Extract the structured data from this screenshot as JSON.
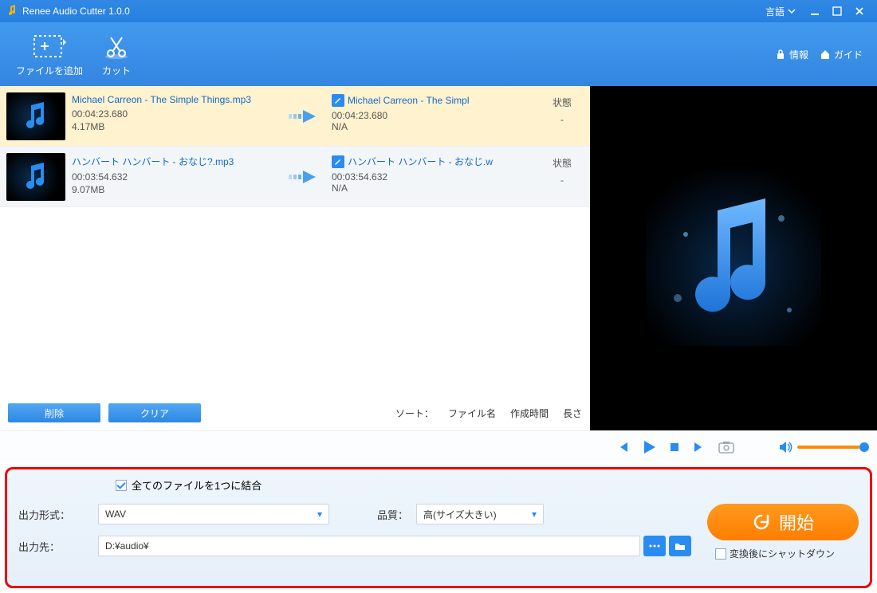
{
  "titlebar": {
    "title": "Renee Audio Cutter 1.0.0",
    "language_label": "言語"
  },
  "toolbar": {
    "add_file": "ファイルを追加",
    "cut": "カット",
    "info": "情報",
    "guide": "ガイド"
  },
  "filelist": {
    "items": [
      {
        "source_name": "Michael Carreon - The Simple Things.mp3",
        "source_duration": "00:04:23.680",
        "source_size": "4.17MB",
        "output_name": "Michael Carreon - The Simpl",
        "output_duration": "00:04:23.680",
        "output_size": "N/A",
        "status_label": "状態",
        "status_value": "-"
      },
      {
        "source_name": "ハンバート ハンバート - おなじ?.mp3",
        "source_duration": "00:03:54.632",
        "source_size": "9.07MB",
        "output_name": "ハンバート ハンバート - おなじ.w",
        "output_duration": "00:03:54.632",
        "output_size": "N/A",
        "status_label": "状態",
        "status_value": "-"
      }
    ],
    "delete": "削除",
    "clear": "クリア",
    "sort_label": "ソート：",
    "sort_opts": {
      "name": "ファイル名",
      "created": "作成時間",
      "length": "長さ"
    }
  },
  "settings": {
    "merge_all": "全てのファイルを1つに結合",
    "output_format_label": "出力形式：",
    "output_format_value": "WAV",
    "quality_label": "品質：",
    "quality_value": "高(サイズ大きい)",
    "output_dir_label": "出力先：",
    "output_dir_value": "D:¥audio¥",
    "start": "開始",
    "shutdown_after": "変換後にシャットダウン"
  }
}
